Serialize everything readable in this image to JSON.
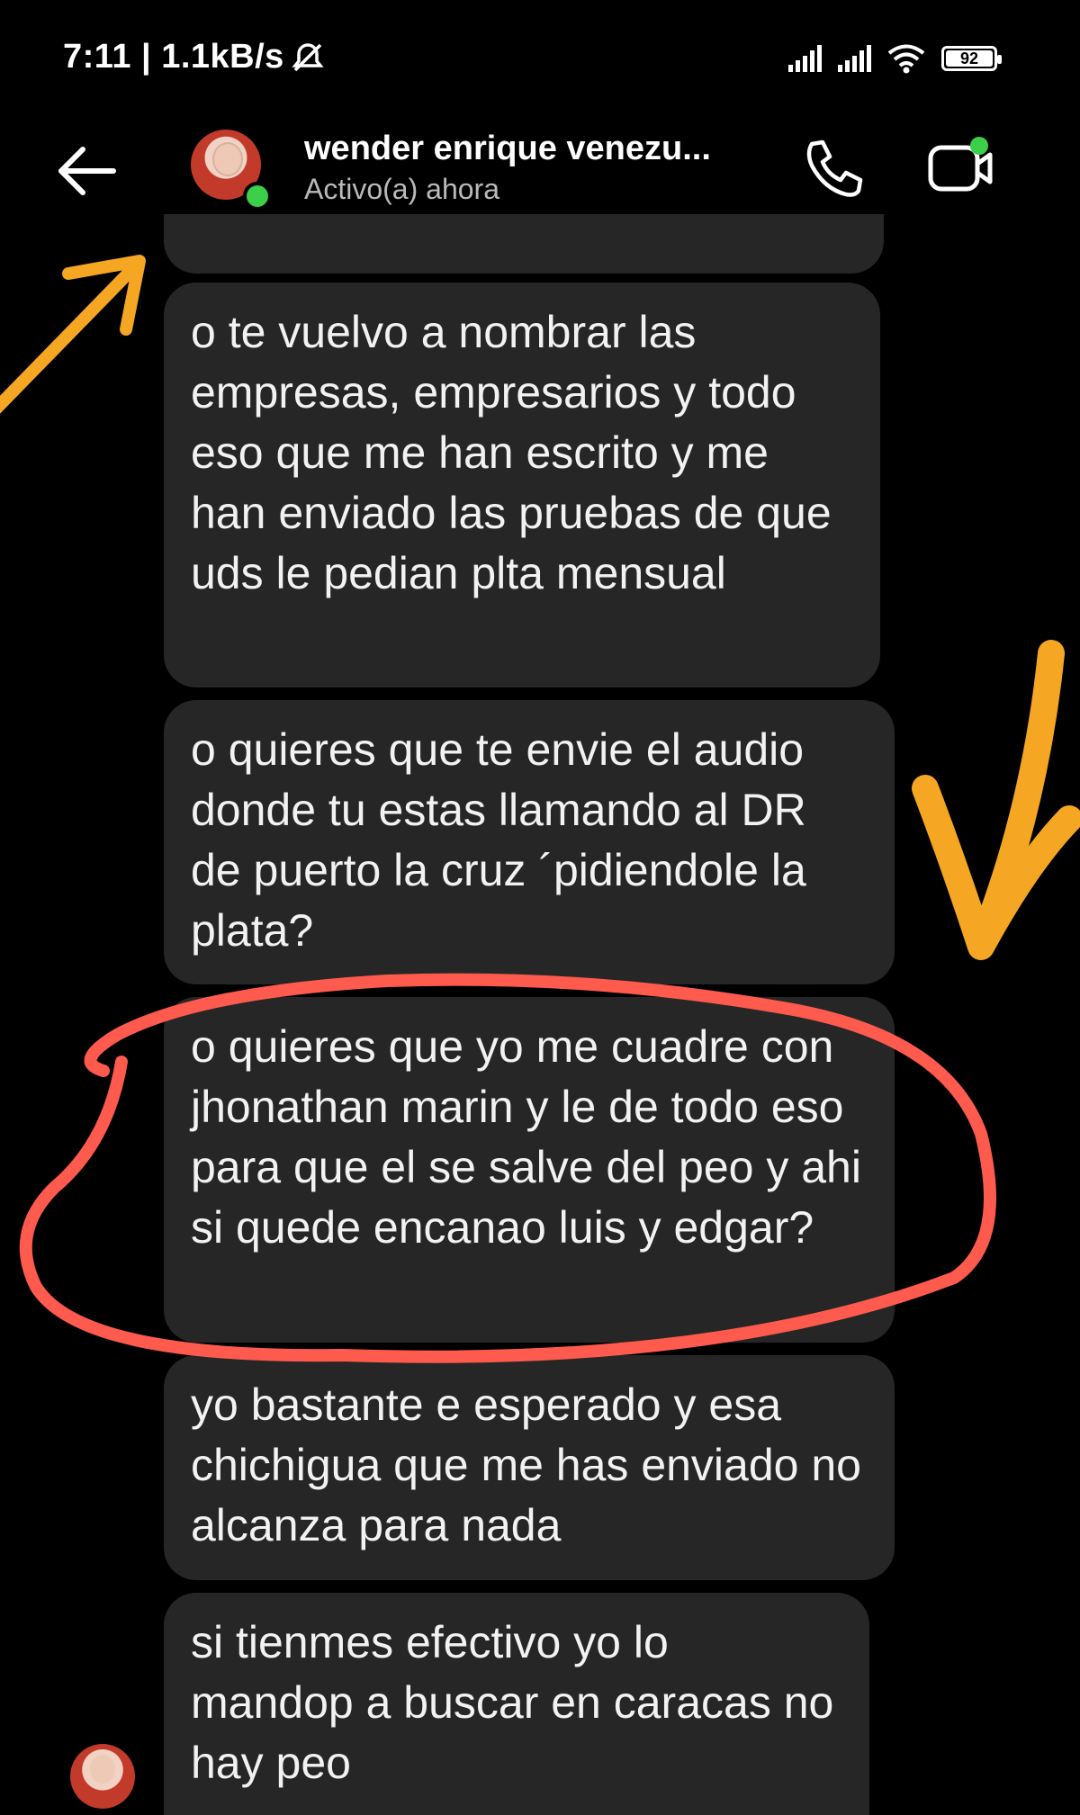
{
  "status_bar": {
    "time_speed": "7:11 | 1.1kB/s",
    "battery": "92"
  },
  "header": {
    "contact_name": "wender enrique venezu...",
    "contact_status": "Activo(a) ahora"
  },
  "messages": [
    {
      "text": "o te vuelvo a nombrar las empresas, empresarios y todo eso que me han escrito y me han enviado las pruebas de que uds le pedian plta mensual"
    },
    {
      "text": "o quieres que te envie el audio donde tu estas llamando al DR de puerto la cruz ´pidiendole la plata?"
    },
    {
      "text": "o quieres que yo me cuadre con jhonathan marin y le de todo eso para que el se salve del peo y ahi si quede encanao luis y edgar?"
    },
    {
      "text": "yo bastante e esperado y esa chichigua que me has enviado no alcanza para nada"
    },
    {
      "text": "si tienmes efectivo yo lo mandop a buscar en caracas no hay peo"
    }
  ],
  "colors": {
    "background": "#000000",
    "bubble": "#262626",
    "online": "#3bcf4a",
    "arrow_annotation": "#f5a623",
    "circle_annotation": "#ff5a4e"
  }
}
